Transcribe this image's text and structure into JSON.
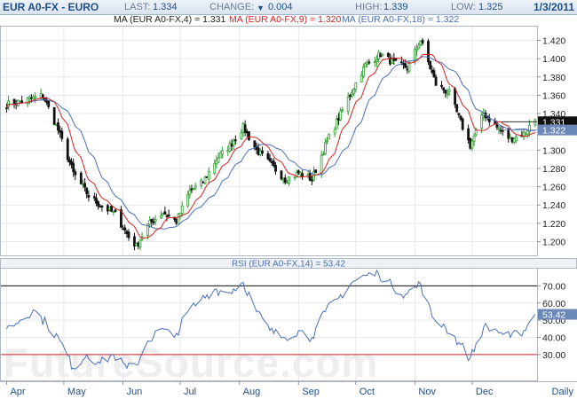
{
  "header": {
    "title": "EUR A0-FX - EURO",
    "last_label": "LAST:",
    "last_value": "1.334",
    "change_label": "CHANGE:",
    "change_value": "0.004",
    "change_direction": "down",
    "high_label": "HIGH:",
    "high_value": "1.339",
    "low_label": "LOW:",
    "low_value": "1.325",
    "date": "1/3/2011"
  },
  "legend": {
    "ma4": "MA (EUR A0-FX,4) = 1.331",
    "ma9": "MA (EUR A0-FX,9) = 1.320",
    "ma18": "MA (EUR A0-FX,18) = 1.322"
  },
  "rsi_legend": "RSI (EUR A0-FX,14) = 53.42",
  "watermark": "FutureSource.com",
  "colors": {
    "ma4": "#222222",
    "ma9": "#d62020",
    "ma18": "#4a6fb5",
    "candle_up": "#2e9e2e",
    "candle_down": "#111111",
    "rsi_line": "#4a6fb5",
    "rsi_overbought": "#111111",
    "rsi_oversold": "#d62020",
    "price_tag_last": "#111111",
    "price_tag_ma": "#6b88b8"
  },
  "chart_data": [
    {
      "type": "candlestick",
      "title": "EUR A0-FX - EURO",
      "x_ticks": [
        "Apr",
        "May",
        "Jun",
        "Jul",
        "Aug",
        "Sep",
        "Oct",
        "Nov",
        "Dec"
      ],
      "x_period_label": "Daily",
      "y_ticks": [
        "1.200",
        "1.220",
        "1.240",
        "1.260",
        "1.280",
        "1.300",
        "1.320",
        "1.340",
        "1.360",
        "1.380",
        "1.400",
        "1.420"
      ],
      "ylim": [
        1.185,
        1.435
      ],
      "grid": true,
      "price_tags": [
        {
          "label": "1.331",
          "value": 1.331,
          "style": "last"
        },
        {
          "label": "1.322",
          "value": 1.322,
          "style": "ma"
        }
      ],
      "close_anchors": [
        [
          "2010-04-01",
          1.35
        ],
        [
          "2010-04-12",
          1.355
        ],
        [
          "2010-04-20",
          1.36
        ],
        [
          "2010-04-28",
          1.322
        ],
        [
          "2010-05-06",
          1.275
        ],
        [
          "2010-05-14",
          1.25
        ],
        [
          "2010-05-20",
          1.24
        ],
        [
          "2010-05-28",
          1.23
        ],
        [
          "2010-06-04",
          1.205
        ],
        [
          "2010-06-08",
          1.195
        ],
        [
          "2010-06-14",
          1.218
        ],
        [
          "2010-06-22",
          1.232
        ],
        [
          "2010-06-29",
          1.222
        ],
        [
          "2010-07-06",
          1.255
        ],
        [
          "2010-07-13",
          1.265
        ],
        [
          "2010-07-20",
          1.29
        ],
        [
          "2010-07-27",
          1.305
        ],
        [
          "2010-08-03",
          1.325
        ],
        [
          "2010-08-10",
          1.3
        ],
        [
          "2010-08-18",
          1.283
        ],
        [
          "2010-08-25",
          1.268
        ],
        [
          "2010-09-01",
          1.275
        ],
        [
          "2010-09-08",
          1.268
        ],
        [
          "2010-09-15",
          1.305
        ],
        [
          "2010-09-22",
          1.335
        ],
        [
          "2010-09-29",
          1.365
        ],
        [
          "2010-10-06",
          1.393
        ],
        [
          "2010-10-14",
          1.405
        ],
        [
          "2010-10-21",
          1.395
        ],
        [
          "2010-10-28",
          1.39
        ],
        [
          "2010-11-04",
          1.42
        ],
        [
          "2010-11-12",
          1.372
        ],
        [
          "2010-11-19",
          1.362
        ],
        [
          "2010-11-26",
          1.325
        ],
        [
          "2010-11-30",
          1.305
        ],
        [
          "2010-12-07",
          1.34
        ],
        [
          "2010-12-14",
          1.325
        ],
        [
          "2010-12-21",
          1.312
        ],
        [
          "2010-12-28",
          1.318
        ],
        [
          "2011-01-03",
          1.334
        ]
      ]
    },
    {
      "type": "line",
      "title": "RSI (EUR A0-FX,14) = 53.42",
      "series": [
        {
          "name": "RSI (EUR A0-FX,14)",
          "points": [
            [
              "2010-04-01",
              45
            ],
            [
              "2010-04-08",
              50
            ],
            [
              "2010-04-15",
              56
            ],
            [
              "2010-04-22",
              48
            ],
            [
              "2010-04-29",
              38
            ],
            [
              "2010-05-06",
              22
            ],
            [
              "2010-05-13",
              30
            ],
            [
              "2010-05-20",
              25
            ],
            [
              "2010-05-27",
              30
            ],
            [
              "2010-06-03",
              22
            ],
            [
              "2010-06-08",
              24
            ],
            [
              "2010-06-14",
              38
            ],
            [
              "2010-06-21",
              45
            ],
            [
              "2010-06-28",
              40
            ],
            [
              "2010-07-05",
              55
            ],
            [
              "2010-07-12",
              62
            ],
            [
              "2010-07-19",
              68
            ],
            [
              "2010-07-26",
              66
            ],
            [
              "2010-08-03",
              72
            ],
            [
              "2010-08-10",
              55
            ],
            [
              "2010-08-17",
              44
            ],
            [
              "2010-08-24",
              40
            ],
            [
              "2010-09-01",
              44
            ],
            [
              "2010-09-08",
              40
            ],
            [
              "2010-09-15",
              55
            ],
            [
              "2010-09-22",
              63
            ],
            [
              "2010-09-29",
              72
            ],
            [
              "2010-10-06",
              76
            ],
            [
              "2010-10-13",
              77
            ],
            [
              "2010-10-20",
              70
            ],
            [
              "2010-10-27",
              65
            ],
            [
              "2010-11-04",
              71
            ],
            [
              "2010-11-10",
              52
            ],
            [
              "2010-11-17",
              46
            ],
            [
              "2010-11-24",
              37
            ],
            [
              "2010-11-30",
              28
            ],
            [
              "2010-12-07",
              46
            ],
            [
              "2010-12-14",
              44
            ],
            [
              "2010-12-21",
              40
            ],
            [
              "2010-12-28",
              44
            ],
            [
              "2011-01-03",
              53.42
            ]
          ]
        }
      ],
      "y_ticks": [
        "30.00",
        "40.00",
        "50.00",
        "60.00",
        "70.00"
      ],
      "ylim": [
        15,
        80
      ],
      "reference_lines": [
        70,
        30
      ],
      "value_tag": "53.42",
      "grid": true
    }
  ]
}
